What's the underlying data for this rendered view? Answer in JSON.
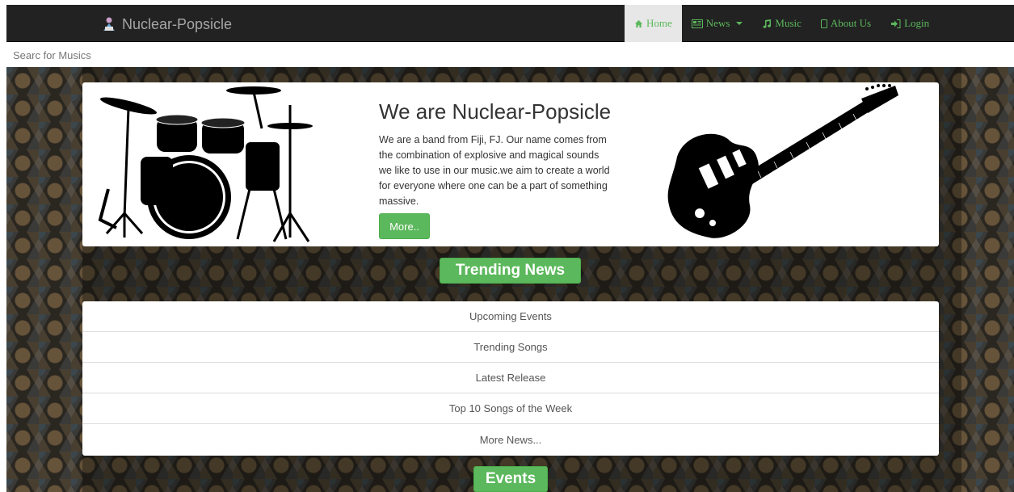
{
  "navbar": {
    "brand": "Nuclear-Popsicle",
    "items": [
      {
        "label": "Home",
        "icon": "home-icon",
        "active": true
      },
      {
        "label": "News",
        "icon": "newspaper-icon",
        "dropdown": true
      },
      {
        "label": "Music",
        "icon": "music-note-icon"
      },
      {
        "label": "About Us",
        "icon": "mobile-icon"
      },
      {
        "label": "Login",
        "icon": "login-icon"
      }
    ]
  },
  "search": {
    "placeholder": "Searc for Musics"
  },
  "hero": {
    "title": "We are Nuclear-Popsicle",
    "text": "We are a band from Fiji, FJ. Our name comes from the combination of explosive and magical sounds we like to use in our music.we aim to create a world for everyone where one can be a part of something massive.",
    "button": "More.."
  },
  "trending": {
    "heading": "Trending News",
    "items": [
      "Upcoming Events",
      "Trending Songs",
      "Latest Release",
      "Top 10 Songs of the Week",
      "More News..."
    ]
  },
  "events": {
    "heading": "Events"
  },
  "colors": {
    "navbar_bg": "#222222",
    "accent_green": "#5cb85c",
    "active_tab_bg": "#e7e7e7"
  }
}
